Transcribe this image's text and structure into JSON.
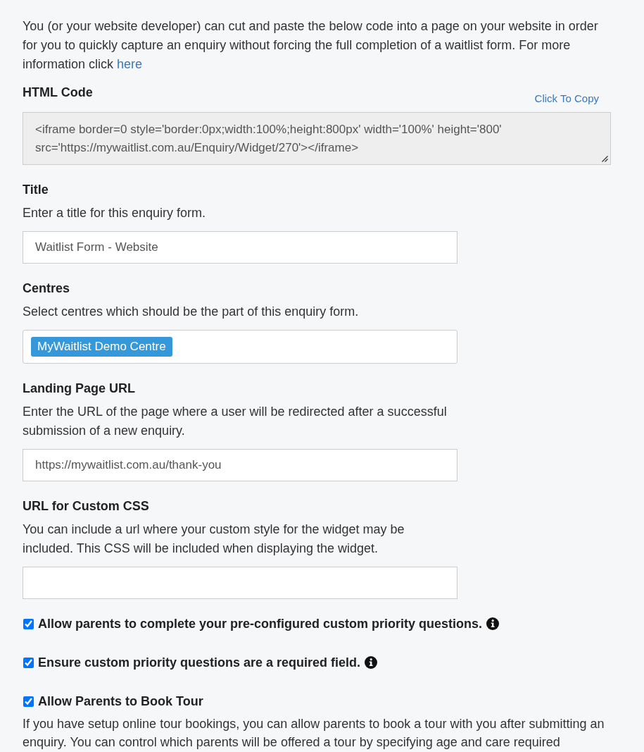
{
  "intro": {
    "text": "You (or your website developer) can cut and paste the below code into a page on your website in order for you to quickly capture an enquiry without forcing the full completion of a waitlist form. For more information click",
    "link": "here"
  },
  "code_section": {
    "label": "HTML Code",
    "copy_link": "Click To Copy",
    "code": "<iframe border=0 style='border:0px;width:100%;height:800px' width='100%' height='800' src='https://mywaitlist.com.au/Enquiry/Widget/270'></iframe>"
  },
  "fields": [
    {
      "kind": "text",
      "label": "Title",
      "description": "Enter a title for this enquiry form.",
      "value": "Waitlist Form - Website"
    },
    {
      "kind": "tags",
      "label": "Centres",
      "description": "Select centres which should be the part of this enquiry form.",
      "tags": [
        "MyWaitlist Demo Centre"
      ]
    },
    {
      "kind": "text",
      "label": "Landing Page URL",
      "description": "Enter the URL of the page where a user will be redirected after a successful submission of a new enquiry.",
      "value": "https://mywaitlist.com.au/thank-you"
    },
    {
      "kind": "text",
      "label": "URL for Custom CSS",
      "description": "You can include a url where your custom style for the widget may be included. This CSS will be included when displaying the widget."
    }
  ],
  "options": [
    {
      "label": "Allow parents to complete your pre-configured custom priority questions.",
      "checked": true,
      "info": true
    },
    {
      "label": "Ensure custom priority questions are a required field.",
      "checked": true,
      "info": true
    },
    {
      "label": "Allow Parents to Book Tour",
      "checked": true,
      "info": false,
      "description": "If you have setup online tour bookings, you can allow parents to book a tour with you after submitting an enquiry. You can control which parents will be offered a tour by specifying age and care required"
    }
  ]
}
